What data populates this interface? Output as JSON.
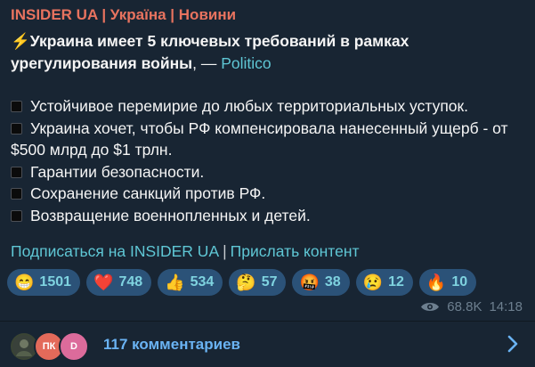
{
  "channel": "INSIDER UA | Україна | Новини",
  "headline": {
    "icon": "⚡",
    "bold": "Украина имеет 5 ключевых требований в рамках урегулирования войны",
    "dash": ", — ",
    "source": "Politico"
  },
  "points": [
    "Устойчивое перемирие до любых территориальных уступок.",
    "Украина хочет, чтобы РФ компенсировала нанесенный ущерб - от $500 млрд до $1 трлн.",
    "Гарантии безопасности.",
    "Сохранение санкций против РФ.",
    "Возвращение военнопленных и детей."
  ],
  "links": {
    "subscribe": "Подписаться на INSIDER UA",
    "separator": "|",
    "send": "Прислать контент"
  },
  "reactions": [
    {
      "emoji": "😁",
      "count": "1501",
      "icon": "grin-emoji"
    },
    {
      "emoji": "❤️",
      "count": "748",
      "icon": "heart-emoji"
    },
    {
      "emoji": "👍",
      "count": "534",
      "icon": "thumbs-up-emoji"
    },
    {
      "emoji": "🤔",
      "count": "57",
      "icon": "thinking-emoji"
    },
    {
      "emoji": "🤬",
      "count": "38",
      "icon": "cursing-emoji"
    },
    {
      "emoji": "😢",
      "count": "12",
      "icon": "crying-emoji"
    },
    {
      "emoji": "🔥",
      "count": "10",
      "icon": "fire-emoji"
    }
  ],
  "meta": {
    "views": "68.8K",
    "time": "14:18"
  },
  "comments": {
    "avatars": [
      "",
      "ПК",
      "D"
    ],
    "label": "117 комментариев"
  },
  "colors": {
    "channel": "#e8735f",
    "link": "#6ab3f3",
    "reaction_bg": "#2b5278",
    "bubble_bg": "#182533"
  }
}
